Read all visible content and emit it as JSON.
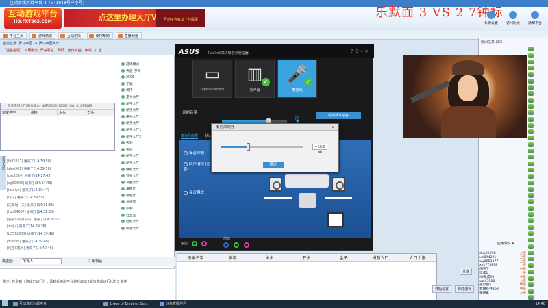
{
  "platform": {
    "window_title": "互动游戏对战平台 4.75 (1648号户小号)",
    "logo_main": "互动游戏平台",
    "logo_url": "HD.FXT365.COM",
    "logo_slogan": "2013 精彩无限 娱乐有你",
    "banner_text": "点这里办理大厅VIP",
    "banner_sub": "互动平台好友上线提醒",
    "stream_overlay": "乐默面 3 VS 2 7钟标",
    "top_icons": [
      {
        "label": "系统设置"
      },
      {
        "label": "访问网页"
      },
      {
        "label": "通知平台"
      }
    ],
    "nav_buttons": [
      "平台主页",
      "游戏商城",
      "互动论坛",
      "使用帮助",
      "直播频道"
    ],
    "breadcrumb": "当前位置: 罗马帝国 -> 罗马帝国大厅",
    "notice": "【温馨提醒】 文明聊天, 严禁恶意、刷屏、宣传外挂、病毒、广告",
    "popup_title": "罗马帝国大厅(简体版本) 本游戏场地[7850], QQ: 41479169",
    "popup_columns": [
      "玩家名字",
      "食物",
      "木头",
      "石头"
    ],
    "sidebar_tab": "游戏大厅",
    "log": [
      {
        "user": "[lb87851]",
        "text": "进来了(14:39:50)"
      },
      {
        "user": "[xlpq901]",
        "text": "进来了(14:39:56)"
      },
      {
        "user": "[cyz2024]",
        "text": "进来了(14:27:43)"
      },
      {
        "user": "[ag69696]",
        "text": "进来了(14:27:43)"
      },
      {
        "user": "[laseiyo]",
        "text": "进来了(14:39:47)"
      },
      {
        "user": "[玛马]",
        "text": "进来了(14:39:55)"
      },
      {
        "user": "[汪耶唱一天]",
        "text": "进来了(14:31:36)"
      },
      {
        "user": "[hzn54687]",
        "text": "进来了(14:31:36)"
      },
      {
        "user": "[骑骑公司疼前日]",
        "text": "进来了(14:35:15)"
      },
      {
        "user": "[zuijia]",
        "text": "离开了(14:39:36)"
      },
      {
        "user": "[b3572603]",
        "text": "进来了(14:39:42)"
      },
      {
        "user": "[z1z2z3]",
        "text": "进来了(14:39:48)"
      },
      {
        "user": "[红宝C遇水]",
        "text": "进来了(14:40:46)"
      }
    ],
    "user_tree": [
      "游戏模式",
      "天道_罗马",
      "2595",
      "丁顺",
      "保持",
      "愚书大厅",
      "新手大厅",
      "新手大厅",
      "愚书大厅",
      "新手大厅",
      "新手大厅1",
      "新手大厅2",
      "天池",
      "天池",
      "新手大厅",
      "新手大厅",
      "精机大厅",
      "顶尖大厅",
      "决胜大厅",
      "掌握厅",
      "丢经厅",
      "休闲室",
      "私聊",
      "自立室",
      "挂机大厅",
      "新手大厅"
    ],
    "chat_label": "发送给:",
    "chat_target": "所有人",
    "chat_send": "发送",
    "chat_checkbox": "悄悄话",
    "hint": "提示: 检测到《游戏已运行》 , 请到桌面和平台游戏启动 [解决游戏运行] 过 3 文件",
    "bottom_columns": [
      "玩家名字",
      "食物",
      "木头",
      "石头",
      "金子",
      "当前人口",
      "人口上限"
    ],
    "right_panel_buttons": [
      "开始设置",
      "启动游戏"
    ],
    "right_text": "房间信息 (1/5)",
    "app_btn": "应用软件",
    "user_list": [
      {
        "name": "duo23098",
        "status": "上级"
      },
      {
        "name": "xsl094221",
        "status": "上级"
      },
      {
        "name": "wy8653077",
        "status": "上级"
      },
      {
        "name": "xxx775898",
        "status": "上级"
      },
      {
        "name": "闲到了",
        "status": "中级"
      },
      {
        "name": "玩家1",
        "status": "上级"
      },
      {
        "name": "XY机成99",
        "status": "中级"
      },
      {
        "name": "wzlx3088",
        "status": "上级"
      },
      {
        "name": "愚默面5",
        "status": "中级"
      },
      {
        "name": "春棚有共369",
        "status": "中级"
      },
      {
        "name": "宰相乘",
        "status": "大将"
      }
    ]
  },
  "sound_manager": {
    "brand": "ASUS",
    "title": "Realtek高清晰音频管理器",
    "devices": [
      {
        "label": "Digital Output",
        "glyph": "▭",
        "active": false
      },
      {
        "label": "扬声器",
        "glyph": "▥",
        "active": false
      },
      {
        "label": "麦克风",
        "glyph": "🎤",
        "active": true
      }
    ],
    "volume_label": "录制音量",
    "volume_level": 0.72,
    "default_button": "设为默认设备",
    "tabs": [
      "麦克风效果",
      "默认格式"
    ],
    "options": [
      "噪音抑制",
      "回声消除 (远场拾音)",
      "会议模式"
    ],
    "footer_label": "模拟",
    "footer_label2": "前面",
    "accent": "#3aa3e0"
  },
  "boost_dialog": {
    "title": "麦克风增强",
    "value": "+10.0 dB",
    "level": 0.33,
    "ok": "确定",
    "close": "×"
  },
  "taskbar": {
    "apps": [
      "互动游戏对战平台",
      "1 Age of Empires Exp...",
      "斗鱼直播伴侣"
    ],
    "clock": "14:40"
  }
}
